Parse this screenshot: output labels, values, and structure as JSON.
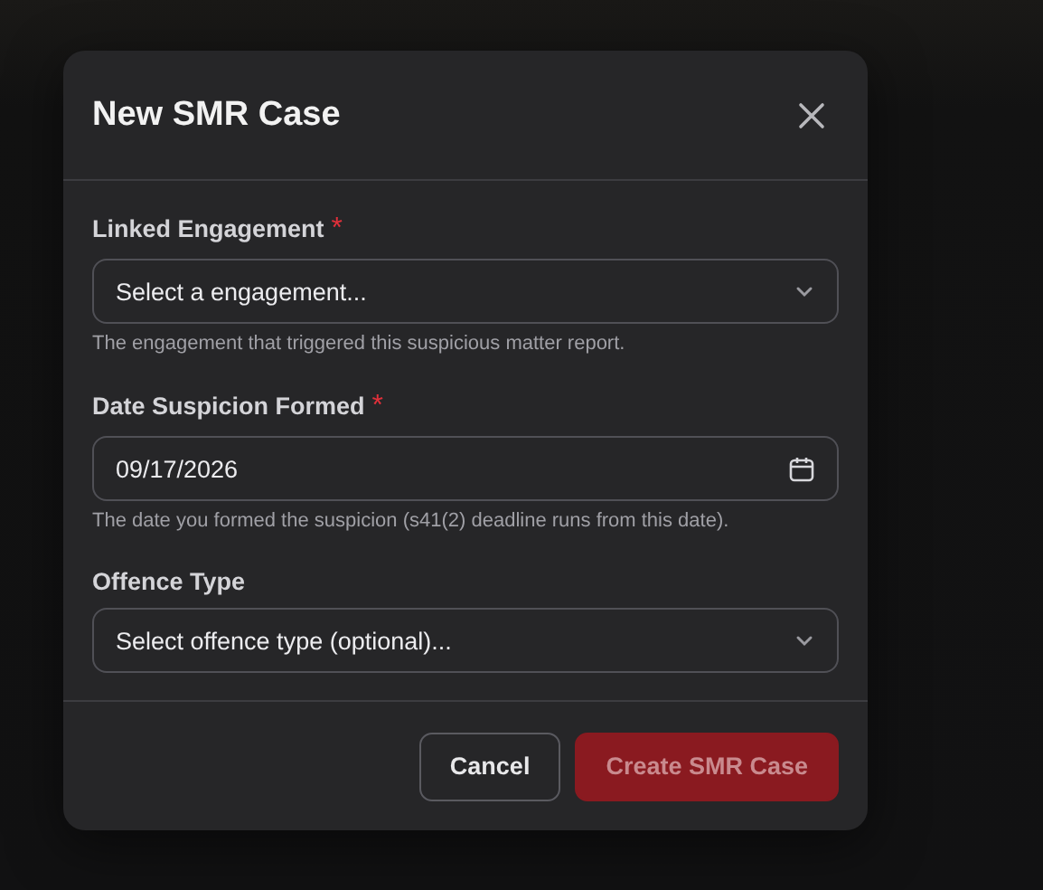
{
  "dialog": {
    "title": "New SMR Case",
    "fields": [
      {
        "kind": "select",
        "label": "Linked Engagement",
        "required_mark": "*",
        "placeholder": "Select a engagement...",
        "help": "The engagement that triggered this suspicious matter report."
      },
      {
        "kind": "date",
        "label": "Date Suspicion Formed",
        "required_mark": "*",
        "value": "09/17/2026",
        "help": "The date you formed the suspicion (s41(2) deadline runs from this date)."
      },
      {
        "kind": "select",
        "label": "Offence Type",
        "placeholder": "Select offence type (optional)..."
      }
    ],
    "buttons": [
      {
        "kind": "secondary",
        "label": "Cancel",
        "disabled": false
      },
      {
        "kind": "primary",
        "label": "Create SMR Case",
        "disabled": true
      }
    ]
  }
}
